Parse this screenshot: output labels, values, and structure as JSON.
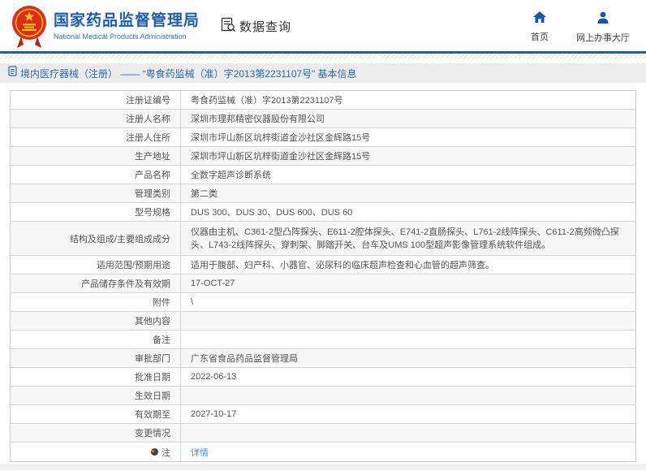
{
  "header": {
    "agency_name": "国家药品监督管理局",
    "agency_name_en": "National Medical Products Administration",
    "module_title": "数据查询",
    "nav_home": "首页",
    "nav_hall": "网上办事大厅"
  },
  "breadcrumb": {
    "text": "境内医疗器械（注册） —— “粤食药监械（准）字2013第2231107号” 基本信息"
  },
  "detail_table": {
    "rows": [
      {
        "label": "注册证编号",
        "value": "粤食药监械（准）字2013第2231107号"
      },
      {
        "label": "注册人名称",
        "value": "深圳市理邦精密仪器股份有限公司"
      },
      {
        "label": "注册人住所",
        "value": "深圳市坪山新区坑梓街道金沙社区金辉路15号"
      },
      {
        "label": "生产地址",
        "value": "深圳市坪山新区坑梓街道金沙社区金辉路15号"
      },
      {
        "label": "产品名称",
        "value": "全数字超声诊断系统"
      },
      {
        "label": "管理类别",
        "value": "第二类"
      },
      {
        "label": "型号规格",
        "value": "DUS 300、DUS 30、DUS 600、DUS 60"
      },
      {
        "label": "结构及组成/主要组成成分",
        "value": "仪器由主机、C361-2型凸阵探头、E611-2腔体探头、E741-2直肠探头、L761-2线阵探头、C611-2高频微凸探头、L743-2线阵探头、穿刺架、脚踏开关、台车及UMS 100型超声影像管理系统软件组成。"
      },
      {
        "label": "适用范围/预期用途",
        "value": "适用于腹部、妇产科、小器官、泌尿科的临床超声检查和心血管的超声筛查。"
      },
      {
        "label": "产品储存条件及有效期",
        "value": "17-OCT-27"
      },
      {
        "label": "附件",
        "value": "\\"
      },
      {
        "label": "其他内容",
        "value": ""
      },
      {
        "label": "备注",
        "value": ""
      },
      {
        "label": "审批部门",
        "value": "广东省食品药品监督管理局"
      },
      {
        "label": "批准日期",
        "value": "2022-06-13"
      },
      {
        "label": "生效日期",
        "value": ""
      },
      {
        "label": "有效期至",
        "value": "2027-10-17"
      },
      {
        "label": "变更情况",
        "value": ""
      },
      {
        "label": "注",
        "value": "详情"
      }
    ]
  },
  "colors": {
    "brand_blue": "#1d5dae",
    "icon_blue": "#1553b8",
    "link_blue": "#4a90d9",
    "breadcrumb_blue": "#2a6cb5"
  }
}
